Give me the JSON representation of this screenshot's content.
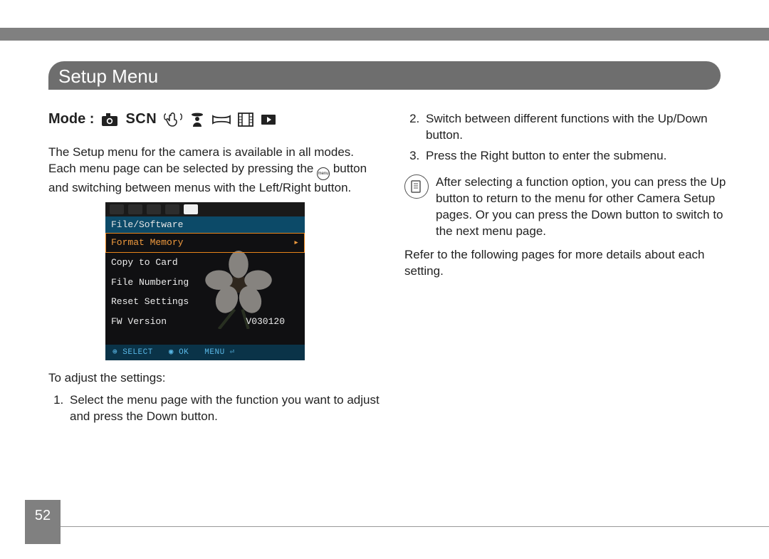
{
  "page_number": "52",
  "header": {
    "title": "Setup Menu"
  },
  "left": {
    "mode_label": "Mode :",
    "mode_scn": "SCN",
    "intro_a": "The Setup menu for the camera is available in all modes. Each menu page can be selected by pressing the ",
    "intro_b": " button and switching between menus with the Left/Right button.",
    "menu_btn_label": "menu",
    "adjust_heading": "To adjust the settings:",
    "steps": [
      "Select the menu page with the function you want to adjust and press the Down button."
    ]
  },
  "lcd": {
    "category": "File/Software",
    "items": [
      {
        "label": "Format Memory",
        "selected": true
      },
      {
        "label": "Copy to Card"
      },
      {
        "label": "File Numbering"
      },
      {
        "label": "Reset Settings"
      },
      {
        "label": "FW Version",
        "value": "V030120"
      }
    ],
    "footer": {
      "select": "SELECT",
      "ok": "OK",
      "menu": "MENU"
    }
  },
  "right": {
    "steps": [
      "Switch between different functions with the Up/Down button.",
      "Press the Right button to enter the submenu."
    ],
    "note": "After selecting a function option, you can press the Up button to return to the menu for other Camera Setup pages. Or you can press the Down button to switch to the next menu page.",
    "closing": "Refer to the following pages for more details about each setting."
  }
}
